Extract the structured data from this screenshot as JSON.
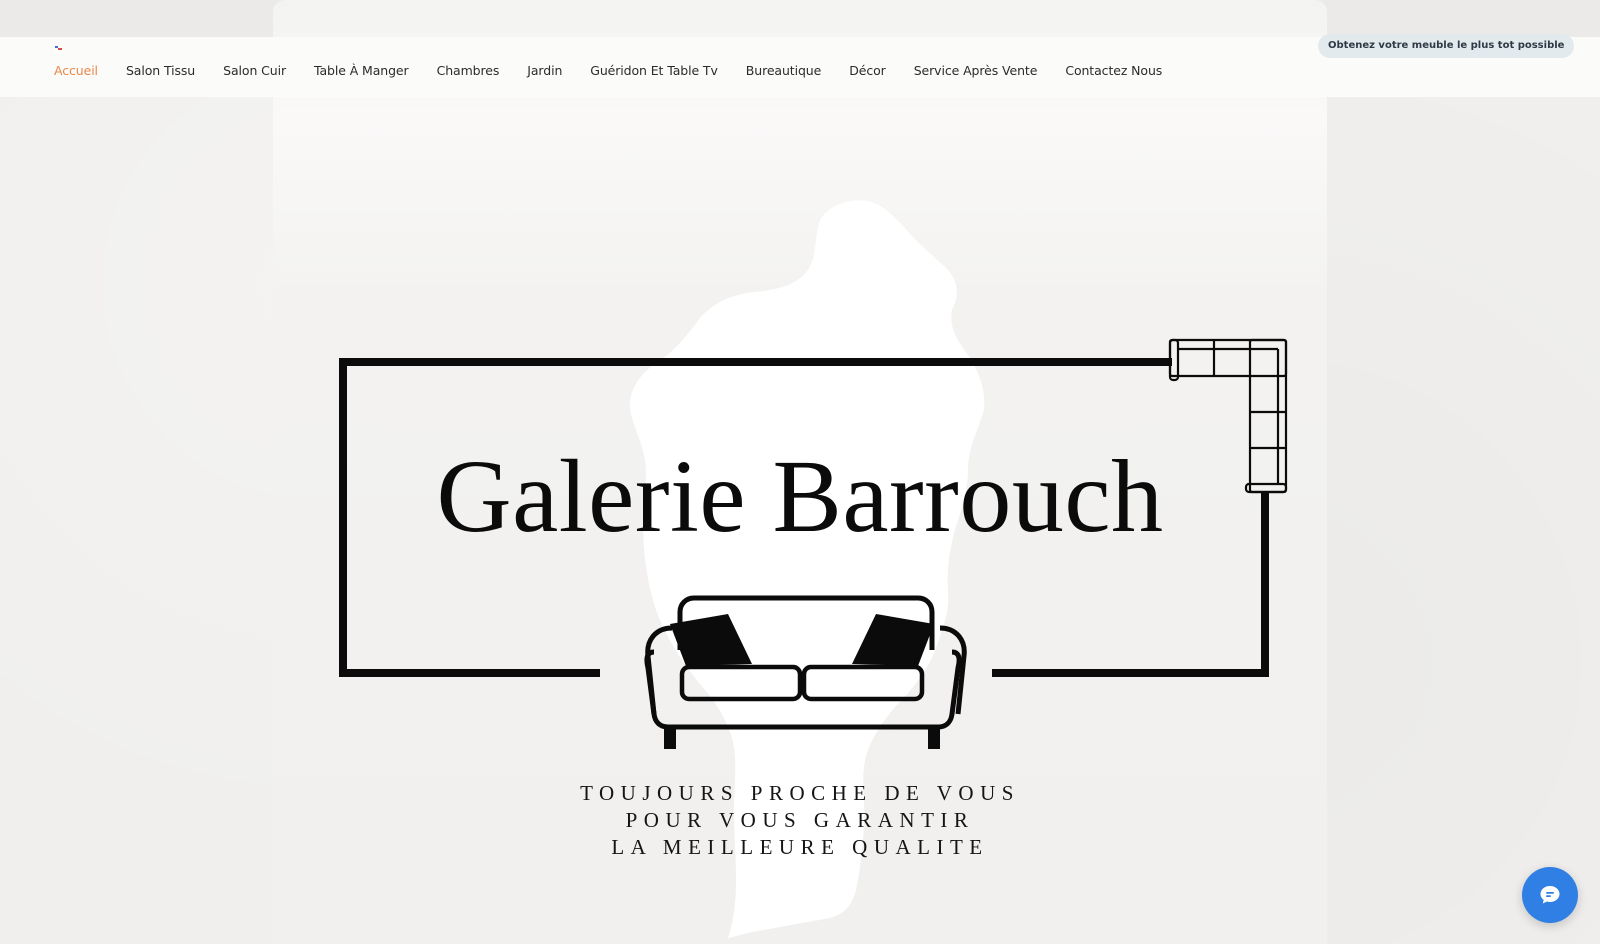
{
  "nav": {
    "items": [
      {
        "label": "Accueil",
        "active": true
      },
      {
        "label": "Salon Tissu"
      },
      {
        "label": "Salon Cuir"
      },
      {
        "label": "Table À Manger"
      },
      {
        "label": "Chambres"
      },
      {
        "label": "Jardin"
      },
      {
        "label": "Guéridon Et Table Tv"
      },
      {
        "label": "Bureautique"
      },
      {
        "label": "Décor"
      },
      {
        "label": "Service Après Vente"
      },
      {
        "label": "Contactez Nous"
      }
    ],
    "cta_label": "Obtenez votre meuble le plus tot possible"
  },
  "hero": {
    "brand_name": "Galerie Barrouch",
    "tagline": [
      "TOUJOURS PROCHE DE VOUS",
      "POUR VOUS GARANTIR",
      "LA MEILLEURE QUALITE"
    ],
    "icons": [
      "sofa-icon",
      "sectional-sofa-icon",
      "map-silhouette"
    ]
  },
  "chat": {
    "icon": "chat-bubble-icon"
  },
  "colors": {
    "accent": "#e8884a",
    "chat_button": "#2f7fe5",
    "cta_background": "#e3eaee",
    "logo_ink": "#0b0b0b"
  }
}
